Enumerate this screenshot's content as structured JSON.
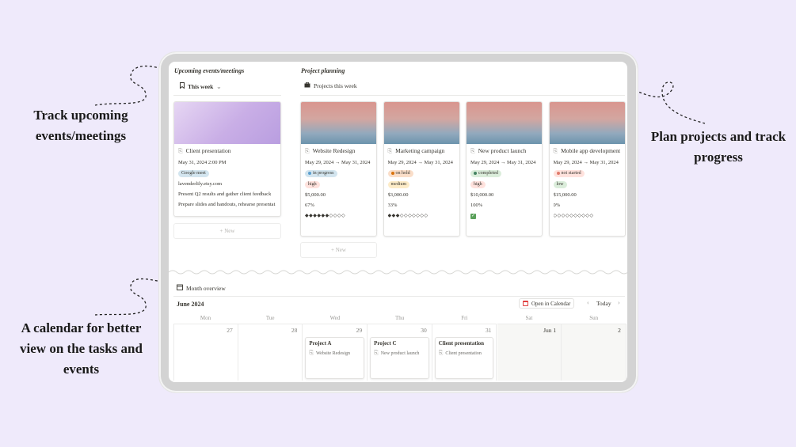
{
  "annotations": {
    "events": [
      "Track upcoming",
      "events/meetings"
    ],
    "projects": [
      "Plan projects and track",
      "progress"
    ],
    "calendar": [
      "A calendar for better",
      "view on the tasks and",
      "events"
    ]
  },
  "events_section": {
    "title": "Upcoming events/meetings",
    "view_label": "This week",
    "card": {
      "title": "Client presentation",
      "datetime": "May 31, 2024 2:00 PM",
      "tag": "Google meet",
      "link": "lavenderlily.etsy.com",
      "line1": "Present Q2 results and gather client feedback",
      "line2": "Prepare slides and handouts, rehearse presentat"
    },
    "new_label": "+ New"
  },
  "projects_section": {
    "title": "Project planning",
    "view_label": "Projects this week",
    "new_label": "+ New",
    "cards": [
      {
        "title": "Website Redesign",
        "dates": "May 29, 2024 → May 31, 2024",
        "status": "in progress",
        "priority": "high",
        "budget": "$5,000.00",
        "progress": "67%",
        "stars": "◆◆◆◆◆◆◇◇◇◇"
      },
      {
        "title": "Marketing campaign",
        "dates": "May 29, 2024 → May 31, 2024",
        "status": "on hold",
        "priority": "medium",
        "budget": "$3,000.00",
        "progress": "33%",
        "stars": "◆◆◆◇◇◇◇◇◇◇"
      },
      {
        "title": "New product launch",
        "dates": "May 29, 2024 → May 31, 2024",
        "status": "completed",
        "priority": "high",
        "budget": "$10,000.00",
        "progress": "100%",
        "stars": "✓"
      },
      {
        "title": "Mobile app development",
        "dates": "May 29, 2024 → May 31, 2024",
        "status": "not started",
        "priority": "low",
        "budget": "$15,000.00",
        "progress": "0%",
        "stars": "◇◇◇◇◇◇◇◇◇◇"
      }
    ],
    "colors": {
      "in_progress_bg": "#d3e5ef",
      "in_progress_dot": "#5c9fcf",
      "on_hold_bg": "#fadec9",
      "on_hold_dot": "#d9730d",
      "completed_bg": "#dbeddb",
      "completed_dot": "#448361",
      "not_started_bg": "#ffe2dd",
      "not_started_dot": "#e07b6b",
      "high_bg": "#ffe2dd",
      "medium_bg": "#fdecc8",
      "low_bg": "#dbeddb"
    }
  },
  "calendar": {
    "view_label": "Month overview",
    "month": "June 2024",
    "open_label": "Open in Calendar",
    "today_label": "Today",
    "weekdays": [
      "Mon",
      "Tue",
      "Wed",
      "Thu",
      "Fri",
      "Sat",
      "Sun"
    ],
    "days": [
      "27",
      "28",
      "29",
      "30",
      "31",
      "Jun 1",
      "2"
    ],
    "events": [
      {
        "title": "Project A",
        "prop": "Website Redesign"
      },
      {
        "title": "Project C",
        "prop": "New product launch"
      },
      {
        "title": "Client presentation",
        "prop": "Client presentation"
      }
    ]
  }
}
